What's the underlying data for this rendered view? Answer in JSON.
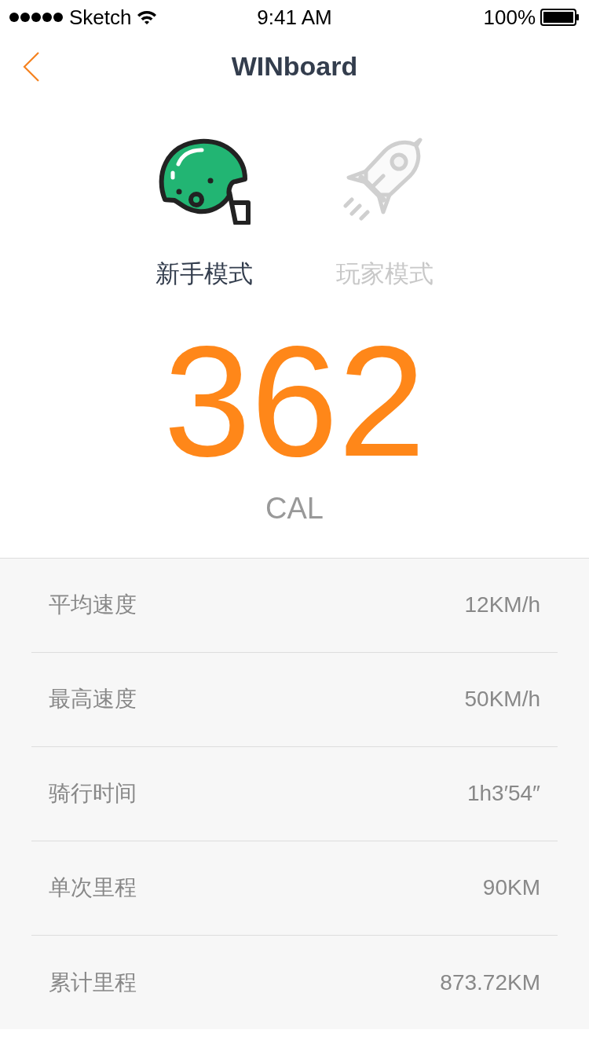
{
  "status_bar": {
    "carrier": "Sketch",
    "time": "9:41 AM",
    "battery": "100%"
  },
  "nav": {
    "title": "WINboard"
  },
  "modes": [
    {
      "kind": "helmet",
      "label": "新手模式",
      "selected": true
    },
    {
      "kind": "rocket",
      "label": "玩家模式",
      "selected": false
    }
  ],
  "calories": {
    "value": "362",
    "unit": "CAL"
  },
  "stats": [
    {
      "label": "平均速度",
      "value": "12KM/h"
    },
    {
      "label": "最高速度",
      "value": "50KM/h"
    },
    {
      "label": "骑行时间",
      "value": "1h3′54″"
    },
    {
      "label": "单次里程",
      "value": "90KM"
    },
    {
      "label": "累计里程",
      "value": "873.72KM"
    }
  ]
}
